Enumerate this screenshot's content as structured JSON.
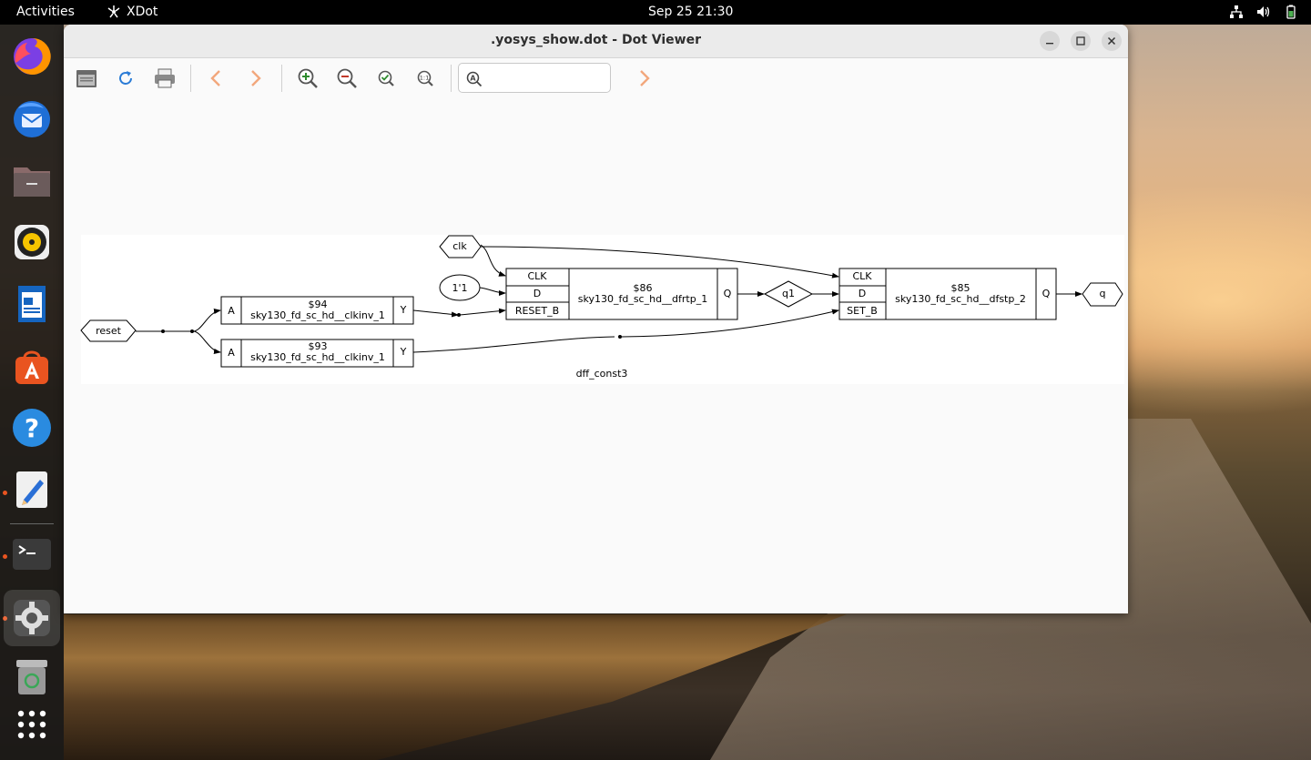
{
  "topbar": {
    "activities": "Activities",
    "app_name": "XDot",
    "clock": "Sep 25  21:30"
  },
  "dock": {
    "items": [
      "firefox-icon",
      "thunderbird-icon",
      "files-icon",
      "rhythmbox-icon",
      "writer-icon",
      "app-center-icon",
      "help-icon",
      "text-editor-icon",
      "terminal-icon",
      "settings-icon",
      "trash-icon",
      "show-apps-icon"
    ]
  },
  "window": {
    "title": ".yosys_show.dot - Dot Viewer",
    "search": {
      "placeholder": "",
      "value": ""
    }
  },
  "graph": {
    "label": "dff_const3",
    "inputs": {
      "clk": "clk",
      "reset": "reset",
      "const": "1'1"
    },
    "wire_q1": "q1",
    "output_q": "q",
    "cell_94": {
      "id": "$94",
      "type": "sky130_fd_sc_hd__clkinv_1",
      "in": "A",
      "out": "Y"
    },
    "cell_93": {
      "id": "$93",
      "type": "sky130_fd_sc_hd__clkinv_1",
      "in": "A",
      "out": "Y"
    },
    "cell_86": {
      "id": "$86",
      "type": "sky130_fd_sc_hd__dfrtp_1",
      "pins": [
        "CLK",
        "D",
        "RESET_B"
      ],
      "out": "Q"
    },
    "cell_85": {
      "id": "$85",
      "type": "sky130_fd_sc_hd__dfstp_2",
      "pins": [
        "CLK",
        "D",
        "SET_B"
      ],
      "out": "Q"
    }
  }
}
